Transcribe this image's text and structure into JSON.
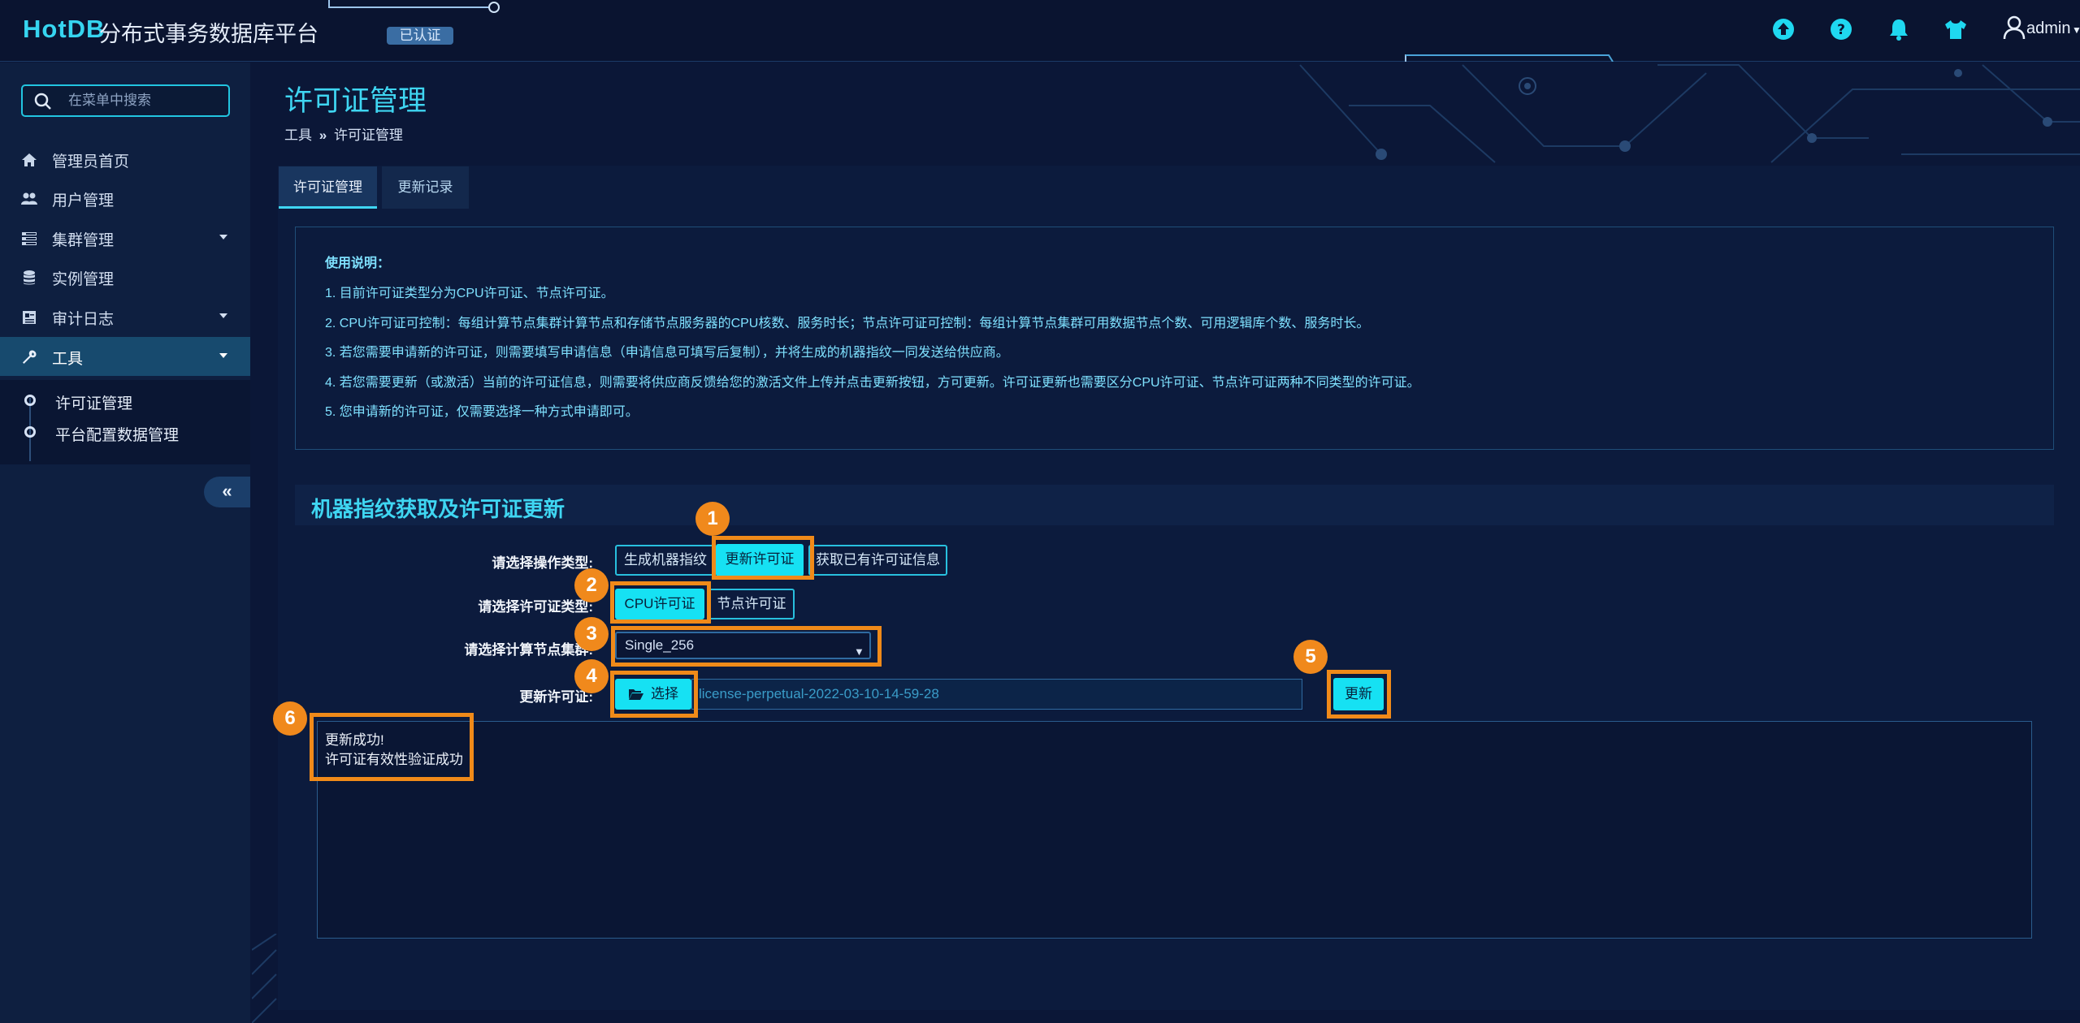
{
  "header": {
    "logo": "HotDB",
    "app_title": "分布式事务数据库平台",
    "cert_badge": "已认证",
    "user": "admin",
    "icons": [
      "upload-icon",
      "help-icon",
      "bell-icon",
      "shirt-icon",
      "user-icon"
    ]
  },
  "sidebar": {
    "search_placeholder": "在菜单中搜索",
    "items": [
      {
        "label": "管理员首页",
        "icon": "home-icon"
      },
      {
        "label": "用户管理",
        "icon": "users-icon"
      },
      {
        "label": "集群管理",
        "icon": "cluster-icon",
        "expandable": true
      },
      {
        "label": "实例管理",
        "icon": "database-icon"
      },
      {
        "label": "审计日志",
        "icon": "audit-log-icon",
        "expandable": true
      },
      {
        "label": "工具",
        "icon": "wrench-icon",
        "expandable": true,
        "active": true
      }
    ],
    "submenu": [
      {
        "label": "许可证管理",
        "active": true
      },
      {
        "label": "平台配置数据管理"
      }
    ],
    "collapse_label": "«"
  },
  "page": {
    "title": "许可证管理",
    "breadcrumb": {
      "parent": "工具",
      "separator": "»",
      "current": "许可证管理"
    }
  },
  "tabs": [
    {
      "label": "许可证管理",
      "active": true
    },
    {
      "label": "更新记录"
    }
  ],
  "instructions": {
    "title": "使用说明：",
    "lines": [
      "1. 目前许可证类型分为CPU许可证、节点许可证。",
      "2. CPU许可证可控制：每组计算节点集群计算节点和存储节点服务器的CPU核数、服务时长；节点许可证可控制：每组计算节点集群可用数据节点个数、可用逻辑库个数、服务时长。",
      "3. 若您需要申请新的许可证，则需要填写申请信息（申请信息可填写后复制），并将生成的机器指纹一同发送给供应商。",
      "4. 若您需要更新（或激活）当前的许可证信息，则需要将供应商反馈给您的激活文件上传并点击更新按钮，方可更新。许可证更新也需要区分CPU许可证、节点许可证两种不同类型的许可证。",
      "5. 您申请新的许可证，仅需要选择一种方式申请即可。"
    ]
  },
  "section": {
    "title": "机器指纹获取及许可证更新"
  },
  "form": {
    "operation_label": "请选择操作类型:",
    "operations": [
      {
        "label": "生成机器指纹"
      },
      {
        "label": "更新许可证",
        "active": true
      },
      {
        "label": "获取已有许可证信息"
      }
    ],
    "license_type_label": "请选择许可证类型:",
    "license_types": [
      {
        "label": "CPU许可证",
        "active": true
      },
      {
        "label": "节点许可证"
      }
    ],
    "cluster_label": "请选择计算节点集群:",
    "cluster_value": "Single_256",
    "update_label": "更新许可证:",
    "choose_label": "选择",
    "file_name": "license-perpetual-2022-03-10-14-59-28",
    "update_button": "更新"
  },
  "result": {
    "lines": [
      "更新成功!",
      "许可证有效性验证成功"
    ]
  },
  "callouts": [
    "1",
    "2",
    "3",
    "4",
    "5",
    "6"
  ],
  "colors": {
    "accent": "#16e1f3",
    "title": "#3fd6f2",
    "callout": "#f0891c",
    "background": "#0b1737",
    "instruction_text": "#7fe1ff"
  }
}
